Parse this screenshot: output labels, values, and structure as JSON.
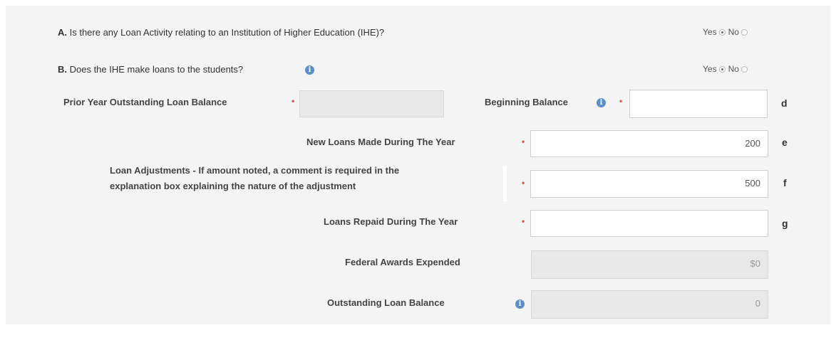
{
  "questions": {
    "a": {
      "prefix": "A.",
      "text": " Is there any Loan Activity relating to an Institution of Higher Education (IHE)?",
      "yes_label": "Yes",
      "no_label": "No",
      "selected": "Yes"
    },
    "b": {
      "prefix": "B.",
      "text": " Does the IHE make loans to the students?",
      "yes_label": "Yes",
      "no_label": "No",
      "selected": "Yes"
    }
  },
  "fields": {
    "prior_year": {
      "label": "Prior Year Outstanding Loan Balance",
      "value": "",
      "required": true,
      "disabled": true
    },
    "beginning": {
      "label": "Beginning Balance",
      "value": "",
      "required": true,
      "suffix": "d"
    },
    "new_loans": {
      "label": "New Loans Made During The Year",
      "value": "200",
      "required": true,
      "suffix": "e"
    },
    "adjustments": {
      "label_line1": "Loan Adjustments - If amount noted, a comment is required in the",
      "label_line2": "explanation box explaining the nature of the adjustment",
      "value": "500",
      "required": true,
      "suffix": "f"
    },
    "repaid": {
      "label": "Loans Repaid During The Year",
      "value": "",
      "required": true,
      "suffix": "g"
    },
    "federal": {
      "label": "Federal Awards Expended",
      "value": "$0",
      "disabled": true
    },
    "outstanding": {
      "label": "Outstanding Loan Balance",
      "value": "0",
      "disabled": true
    }
  },
  "required_marker": "•",
  "info_glyph": "i",
  "colors": {
    "panel": "#f4f4f4",
    "required": "#d9534f",
    "info": "#5b8fc7"
  }
}
